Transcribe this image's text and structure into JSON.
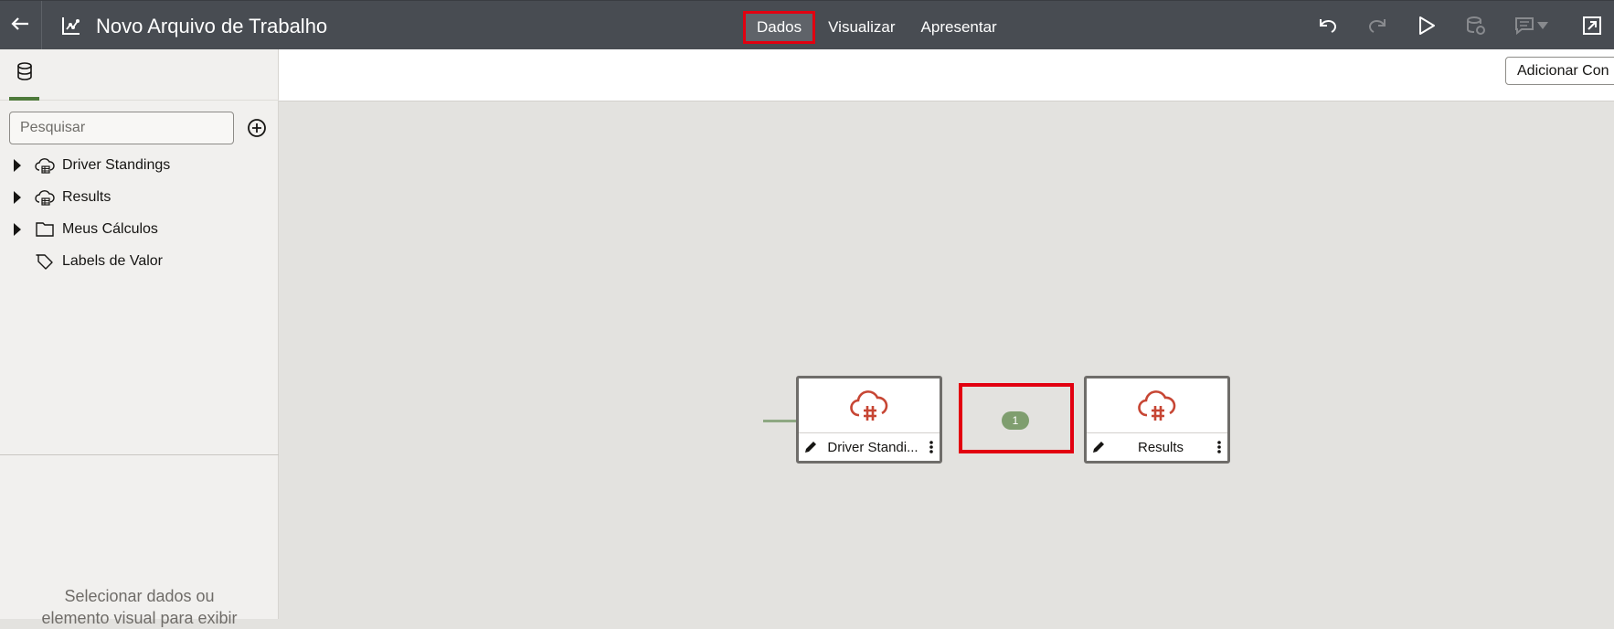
{
  "topbar": {
    "title": "Novo Arquivo de Trabalho",
    "tabs": [
      {
        "label": "Dados",
        "active": true
      },
      {
        "label": "Visualizar",
        "active": false
      },
      {
        "label": "Apresentar",
        "active": false
      }
    ],
    "icons": [
      "back-arrow-icon",
      "workbook-chart-icon",
      "undo-icon",
      "redo-icon",
      "play-icon",
      "refresh-data-icon",
      "comment-icon",
      "chevron-down-icon",
      "expand-icon"
    ]
  },
  "left_panel": {
    "search": {
      "placeholder": "Pesquisar",
      "value": ""
    },
    "tree": [
      {
        "label": "Driver Standings",
        "icon": "cloud-dataset-icon",
        "expandable": true
      },
      {
        "label": "Results",
        "icon": "cloud-dataset-icon",
        "expandable": true
      },
      {
        "label": "Meus Cálculos",
        "icon": "folder-icon",
        "expandable": true
      },
      {
        "label": "Labels de Valor",
        "icon": "tag-icon",
        "expandable": false
      }
    ],
    "empty_text_lines": [
      "Selecionar dados ou",
      "elemento visual para exibir"
    ]
  },
  "main_toolbar": {
    "add_condition_label": "Adicionar Con"
  },
  "canvas": {
    "nodes": [
      {
        "label": "Driver Standi...",
        "icon": "cloud-table-icon"
      },
      {
        "label": "Results",
        "icon": "cloud-table-icon"
      }
    ],
    "join": {
      "count": "1"
    }
  },
  "colors": {
    "topbar_bg": "#484c52",
    "highlight": "#e20010",
    "accent_green": "#4e7a3b",
    "join_green": "#7f9e6f",
    "dataset_icon_red": "#c74634"
  }
}
